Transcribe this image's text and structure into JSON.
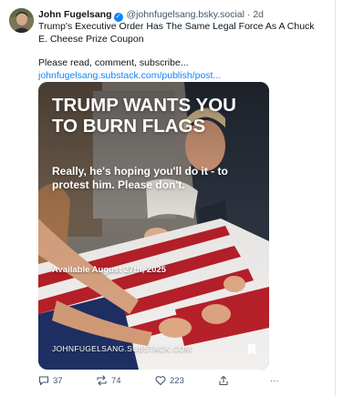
{
  "post": {
    "author_name": "John Fugelsang",
    "handle": "@johnfugelsang.bsky.social",
    "separator": "·",
    "age": "2d",
    "text_line1": "Trump's Executive Order Has The Same Legal Force As A Chuck E. Cheese Prize Coupon",
    "text_line2": "Please read, comment, subscribe...",
    "link_text": "johnfugelsang.substack.com/publish/post..."
  },
  "card": {
    "headline": "TRUMP WANTS YOU TO BURN FLAGS",
    "subhead": "Really, he's hoping you'll do it - to protest him. Please don't.",
    "available": "Available August 27th, 2025",
    "brand": "JOHNFUGELSANG.SUBSTACK.COM"
  },
  "actions": {
    "replies": "37",
    "reposts": "74",
    "likes": "223",
    "more": "···"
  },
  "colors": {
    "link": "#1083fe",
    "secondary_text": "#42576c",
    "flag_red": "#b8202a",
    "flag_blue": "#1e2f63"
  },
  "icons": [
    "verified-badge-icon",
    "reply-icon",
    "repost-icon",
    "like-icon",
    "share-icon",
    "more-icon",
    "bookmark-icon"
  ]
}
